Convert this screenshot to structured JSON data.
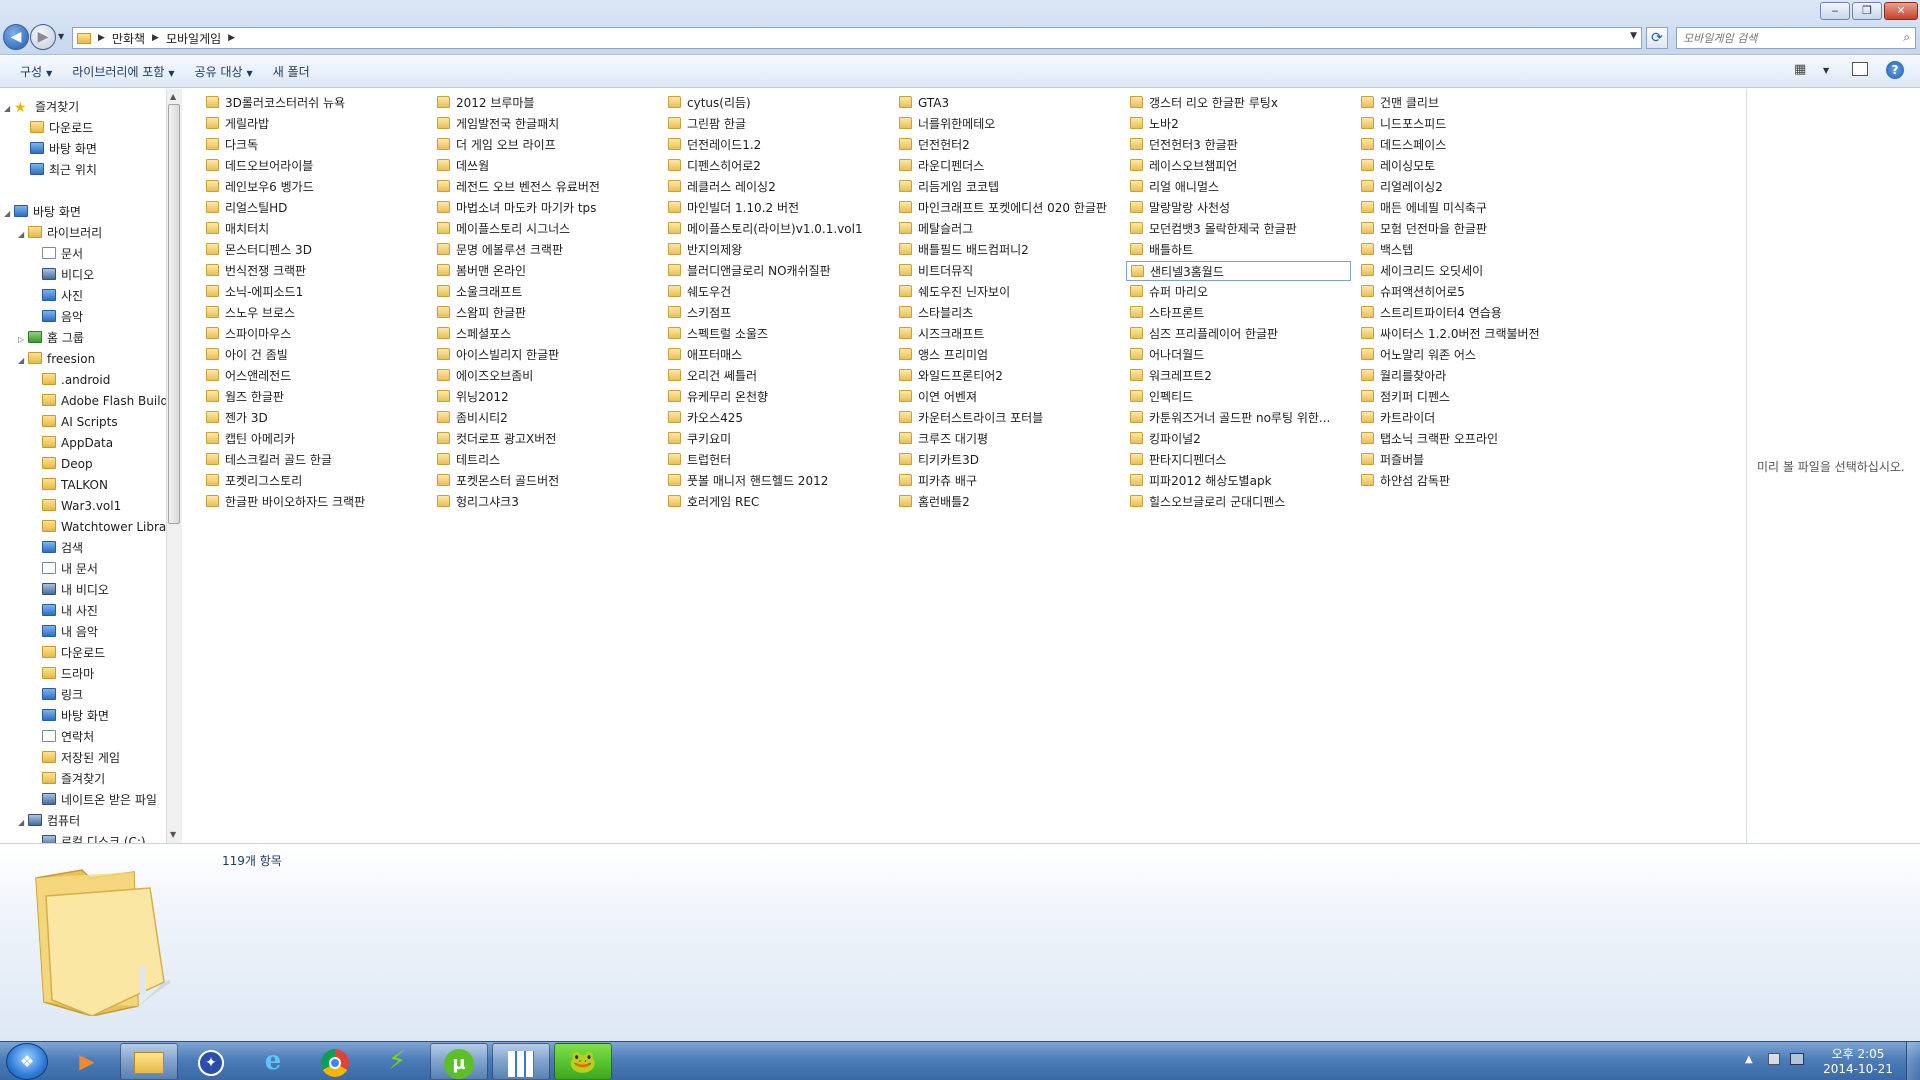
{
  "window": {
    "controls": {
      "minimize": "‒",
      "maximize": "❐",
      "close": "✕"
    }
  },
  "address_bar": {
    "crumbs": [
      "만화책",
      "모바일게임"
    ],
    "search_placeholder": "모바일게임 검색"
  },
  "toolbar": {
    "organize": "구성",
    "include_in_library": "라이브러리에 포함",
    "share_with": "공유 대상",
    "new_folder": "새 폴더"
  },
  "nav_pane": {
    "favorites": "즐겨찾기",
    "downloads": "다운로드",
    "desktop_fav": "바탕 화면",
    "recent": "최근 위치",
    "desktop": "바탕 화면",
    "libraries": "라이브러리",
    "lib_docs": "문서",
    "lib_video": "비디오",
    "lib_pics": "사진",
    "lib_music": "음악",
    "homegroup": "홈 그룹",
    "user": "freesion",
    "user_items": [
      ".android",
      "Adobe Flash Builder",
      "AI Scripts",
      "AppData",
      "Deop",
      "TALKON",
      "War3.vol1",
      "Watchtower Library",
      "검색",
      "내 문서",
      "내 비디오",
      "내 사진",
      "내 음악",
      "다운로드",
      "드라마",
      "링크",
      "바탕 화면",
      "연락처",
      "저장된 게임",
      "즐겨찾기",
      "네이트온 받은 파일"
    ],
    "computer": "컴퓨터",
    "local_disk": "로컬 디스크 (C:)"
  },
  "files": [
    [
      "3D롤러코스터러쉬 뉴욕",
      "게릴라밥",
      "다크독",
      "데드오브어라이블",
      "레인보우6 벵가드",
      "리얼스틸HD",
      "매치터치",
      "몬스터디펜스 3D",
      "번식전쟁 크랙판",
      "소닉-에피소드1",
      "스노우 브로스",
      "스파이마우스",
      "아이 건 좀빌",
      "어스앤레전드",
      "웜즈 한글판",
      "젠가 3D",
      "캡틴 아메리카",
      "테스크킬러 골드 한글",
      "포켓리그스토리",
      "한글판 바이오하자드 크랙판"
    ],
    [
      "2012 브루마블",
      "게임발전국 한글패치",
      "더 게임 오브 라이프",
      "데쓰웜",
      "레전드 오브 벤전스 유료버전",
      "마법소녀 마도카 마기카 tps",
      "메이플스토리 시그너스",
      "문명 에볼루션 크랙판",
      "봄버맨 온라인",
      "소울크래프트",
      "스왐피 한글판",
      "스페셜포스",
      "아이스빌리지 한글판",
      "에이즈오브좀비",
      "위닝2012",
      "좀비시티2",
      "컷더로프 광고X버전",
      "테트리스",
      "포켓몬스터 골드버전",
      "헝리그샤크3"
    ],
    [
      "cytus(리듬)",
      "그린팜 한글",
      "던전레이드1.2",
      "디펜스히어로2",
      "레클러스 레이싱2",
      "마인빌더 1.10.2 버전",
      "메이플스토리(라이브)v1.0.1.vol1",
      "반지의제왕",
      "블러디앤글로리 NO캐쉬질판",
      "쉐도우건",
      "스키점프",
      "스펙트럴 소울즈",
      "애프터매스",
      "오리건 쎄틀러",
      "유케무리 온천향",
      "카오스425",
      "쿠키요미",
      "트럽헌터",
      "풋볼 매니저 핸드헬드 2012",
      "호러게임 REC"
    ],
    [
      "GTA3",
      "너를위한메테오",
      "던전헌터2",
      "라운디펜더스",
      "리듬게임 코코텝",
      "마인크래프트 포켓에디션 020 한글판",
      "메탈슬러그",
      "배틀필드 배드컴퍼니2",
      "비트더뮤직",
      "쉐도우진 닌자보이",
      "스타블리츠",
      "시즈크래프트",
      "앵스 프리미엄",
      "와일드프론티어2",
      "이연 어벤져",
      "카운터스트라이크 포터블",
      "크루즈 대기평",
      "티키카트3D",
      "피카츄 배구",
      "홈런배틀2"
    ],
    [
      "갱스터 리오 한글판 루팅x",
      "노바2",
      "던전헌터3 한글판",
      "레이스오브챔피언",
      "리얼 애니멀스",
      "말랑말랑 사천성",
      "모던컴뱃3 몰락한제국 한글판",
      "배틀하트",
      "샌티넬3홈월드",
      "슈퍼 마리오",
      "스타프론트",
      "심즈 프리플레이어 한글판",
      "어나더월드",
      "워크레프트2",
      "인펙티드",
      "카툰워즈거너 골드판 no루팅 위한...",
      "킹파이널2",
      "판타지디펜더스",
      "피파2012 해상도별apk",
      "힐스오브글로리 군대디펜스"
    ],
    [
      "건맨 클리브",
      "니드포스피드",
      "데드스페이스",
      "레이싱모토",
      "리얼레이싱2",
      "매든 에네필 미식축구",
      "모험 던전마을 한글판",
      "백스텝",
      "세이크리드 오딧세이",
      "슈퍼액션히어로5",
      "스트리트파이터4 연습용",
      "싸이터스 1.2.0버전 크랙불버전",
      "어노말리 워존 어스",
      "월리를찾아라",
      "점키퍼 디펜스",
      "카트라이더",
      "탭소닉 크랙판 오프라인",
      "퍼즐버블",
      "하얀섬 감독판"
    ]
  ],
  "selected_file": "샌티넬3홈월드",
  "preview_text": "미리 볼 파일을 선택하십시오.",
  "details": {
    "item_count": "119개 항목"
  },
  "taskbar": {
    "time": "오후 2:05",
    "date": "2014-10-21"
  }
}
